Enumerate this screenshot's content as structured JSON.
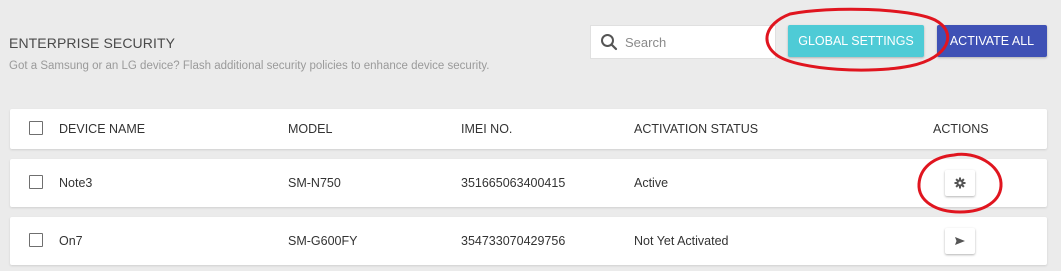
{
  "header": {
    "title": "ENTERPRISE SECURITY",
    "subtitle": "Got a Samsung or an LG device? Flash additional security policies to enhance device security."
  },
  "search": {
    "placeholder": "Search",
    "icon": "search-icon"
  },
  "buttons": {
    "global_settings": "GLOBAL SETTINGS",
    "activate_all": "ACTIVATE ALL"
  },
  "colors": {
    "global_settings_bg": "#4ecbd6",
    "activate_all_bg": "#3f51b5",
    "annotation": "#e0151f"
  },
  "table": {
    "columns": {
      "device_name": "DEVICE NAME",
      "model": "MODEL",
      "imei": "IMEI NO.",
      "status": "ACTIVATION STATUS",
      "actions": "ACTIONS"
    },
    "rows": [
      {
        "device_name": "Note3",
        "model": "SM-N750",
        "imei": "351665063400415",
        "status": "Active",
        "action_icon": "gear-icon"
      },
      {
        "device_name": "On7",
        "model": "SM-G600FY",
        "imei": "354733070429756",
        "status": "Not Yet Activated",
        "action_icon": "send-icon"
      }
    ]
  }
}
